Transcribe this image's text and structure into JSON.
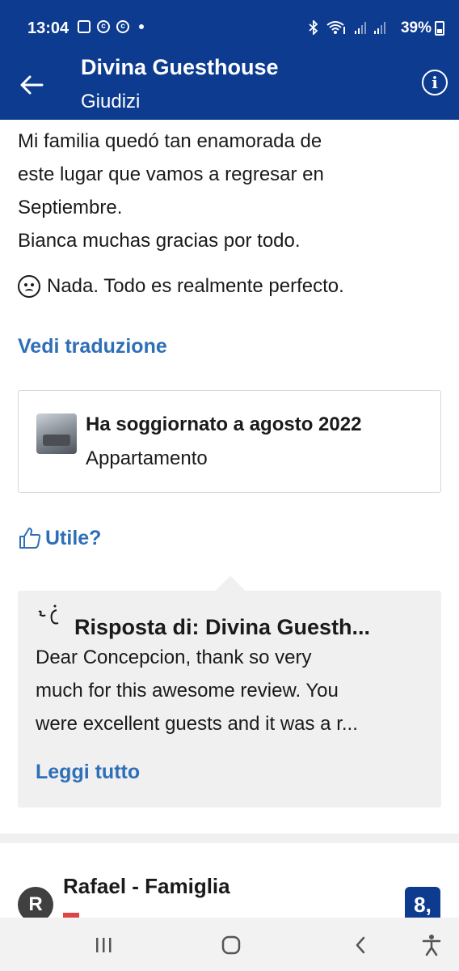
{
  "status_bar": {
    "time": "13:04",
    "battery": "39%"
  },
  "header": {
    "title": "Divina Guesthouse",
    "subtitle": "Giudizi"
  },
  "review": {
    "lines": [
      "Mi familia quedó tan enamorada de",
      "este lugar que vamos a regresar en",
      "Septiembre.",
      "Bianca muchas gracias por todo."
    ],
    "negative": "Nada. Todo es realmente perfecto.",
    "translate_label": "Vedi traduzione"
  },
  "stay": {
    "title": "Ha soggiornato a agosto 2022",
    "room_type": "Appartamento"
  },
  "helpful_label": "Utile?",
  "reply": {
    "title": "Risposta di: Divina Guesth...",
    "body_lines": [
      "Dear Concepcion, thank so very",
      "much for this awesome review. You",
      "were excellent guests and it was a r..."
    ],
    "read_all_label": "Leggi tutto"
  },
  "next_review": {
    "avatar_letter": "R",
    "name": "Rafael - Famiglia",
    "score": "8,"
  },
  "colors": {
    "brand": "#0d3b8f",
    "link": "#2e6fb7"
  }
}
